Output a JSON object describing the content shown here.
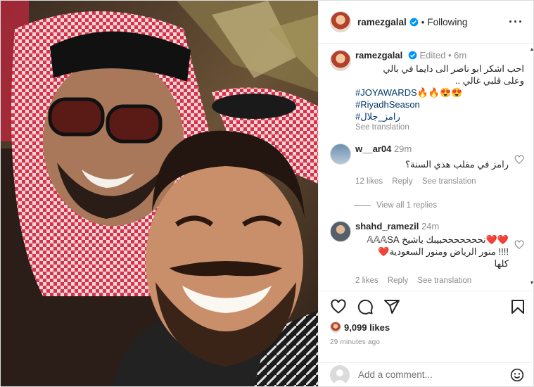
{
  "post": {
    "username": "ramezgalal",
    "follow_status": "Following",
    "more_icon": "more-horizontal-icon"
  },
  "caption": {
    "username": "ramezgalal",
    "edited": "Edited",
    "time": "6m",
    "line1": "احب اشكر ابو ناصر الى دايما في بالي",
    "line2": "وعلى قلبي غالي ..",
    "hashtag1": "#JOYAWARDS",
    "hashtag1_emoji": "🔥🔥😍😍",
    "hashtag2": "#RiyadhSeason",
    "hashtag3": "#رامز_جلال",
    "see_translation": "See translation"
  },
  "comments": [
    {
      "username": "w__ar04",
      "time": "29m",
      "text": "رامز في مقلب هذي السنة؟",
      "likes": "12 likes",
      "reply": "Reply",
      "translate": "See translation"
    },
    {
      "username": "shahd_ramezil",
      "time": "24m",
      "text_line1_hearts": "❤️❤️",
      "text_line1": "نحححححححبيبك ياشيخ 𝔸𝔸𝔸SA",
      "text_line2": "!!!! منور الرياض ومنور السعودية",
      "text_line2_hearts": "❤️",
      "text_line3": "كلها",
      "likes": "2 likes",
      "reply": "Reply",
      "translate": "See translation"
    }
  ],
  "view_replies": "View all 1 replies",
  "likes_count": "9,099 likes",
  "posted_time": "29 minutes ago",
  "add_comment_placeholder": "Add a comment...",
  "colors": {
    "hashtag": "#00376b",
    "verified": "#0095f6",
    "muted": "#8e8e8e"
  }
}
